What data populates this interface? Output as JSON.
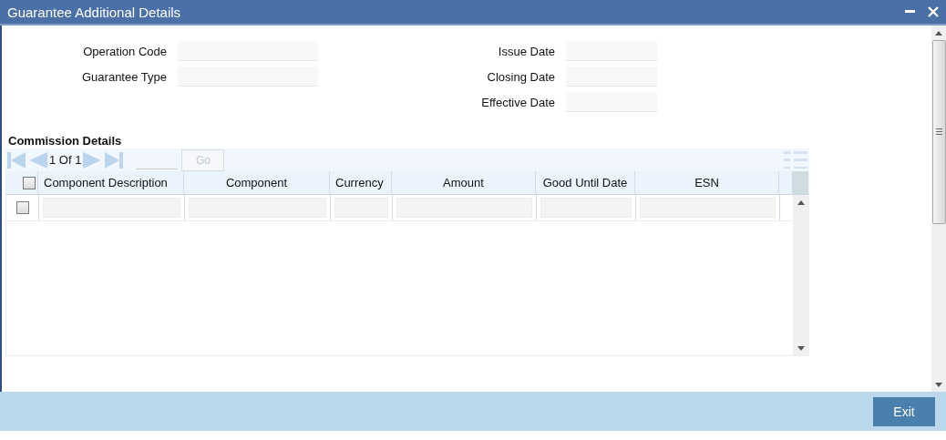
{
  "window": {
    "title": "Guarantee Additional Details"
  },
  "left_fields": [
    {
      "label": "Operation Code"
    },
    {
      "label": "Guarantee Type"
    }
  ],
  "right_fields": [
    {
      "label": "Issue Date"
    },
    {
      "label": "Closing Date"
    },
    {
      "label": "Effective Date"
    }
  ],
  "commission_details": {
    "heading": "Commission Details",
    "pagination": {
      "page_text": "1 Of 1",
      "go_button": {
        "label": "Go",
        "disabled": true
      }
    },
    "select_all_checked": false,
    "columns": [
      "Component Description",
      "Component",
      "Currency",
      "Amount",
      "Good Until Date",
      "ESN"
    ],
    "rows": [
      {
        "checked": false
      }
    ]
  },
  "footer": {
    "buttons": [
      "Exit"
    ]
  }
}
